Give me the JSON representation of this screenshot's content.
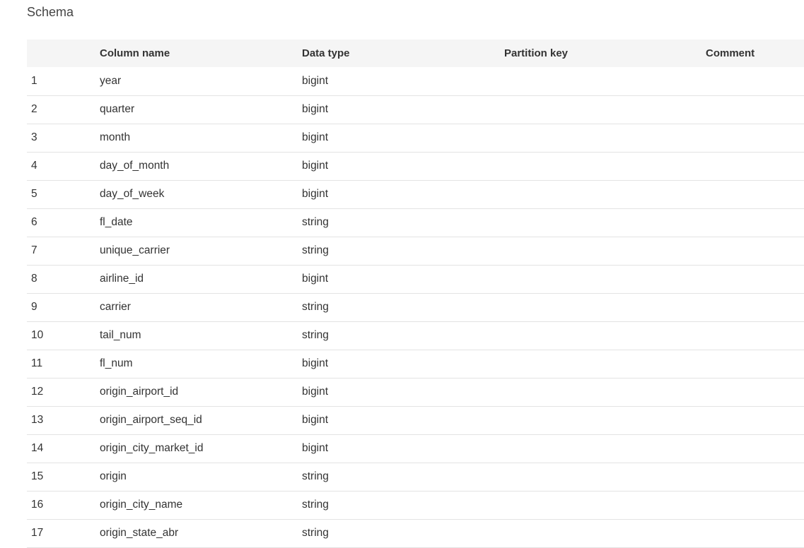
{
  "section": {
    "title": "Schema"
  },
  "table": {
    "headers": {
      "index": "",
      "column_name": "Column name",
      "data_type": "Data type",
      "partition_key": "Partition key",
      "comment": "Comment"
    },
    "rows": [
      {
        "index": "1",
        "name": "year",
        "type": "bigint",
        "partition": "",
        "comment": ""
      },
      {
        "index": "2",
        "name": "quarter",
        "type": "bigint",
        "partition": "",
        "comment": ""
      },
      {
        "index": "3",
        "name": "month",
        "type": "bigint",
        "partition": "",
        "comment": ""
      },
      {
        "index": "4",
        "name": "day_of_month",
        "type": "bigint",
        "partition": "",
        "comment": ""
      },
      {
        "index": "5",
        "name": "day_of_week",
        "type": "bigint",
        "partition": "",
        "comment": ""
      },
      {
        "index": "6",
        "name": "fl_date",
        "type": "string",
        "partition": "",
        "comment": ""
      },
      {
        "index": "7",
        "name": "unique_carrier",
        "type": "string",
        "partition": "",
        "comment": ""
      },
      {
        "index": "8",
        "name": "airline_id",
        "type": "bigint",
        "partition": "",
        "comment": ""
      },
      {
        "index": "9",
        "name": "carrier",
        "type": "string",
        "partition": "",
        "comment": ""
      },
      {
        "index": "10",
        "name": "tail_num",
        "type": "string",
        "partition": "",
        "comment": ""
      },
      {
        "index": "11",
        "name": "fl_num",
        "type": "bigint",
        "partition": "",
        "comment": ""
      },
      {
        "index": "12",
        "name": "origin_airport_id",
        "type": "bigint",
        "partition": "",
        "comment": ""
      },
      {
        "index": "13",
        "name": "origin_airport_seq_id",
        "type": "bigint",
        "partition": "",
        "comment": ""
      },
      {
        "index": "14",
        "name": "origin_city_market_id",
        "type": "bigint",
        "partition": "",
        "comment": ""
      },
      {
        "index": "15",
        "name": "origin",
        "type": "string",
        "partition": "",
        "comment": ""
      },
      {
        "index": "16",
        "name": "origin_city_name",
        "type": "string",
        "partition": "",
        "comment": ""
      },
      {
        "index": "17",
        "name": "origin_state_abr",
        "type": "string",
        "partition": "",
        "comment": ""
      }
    ]
  }
}
